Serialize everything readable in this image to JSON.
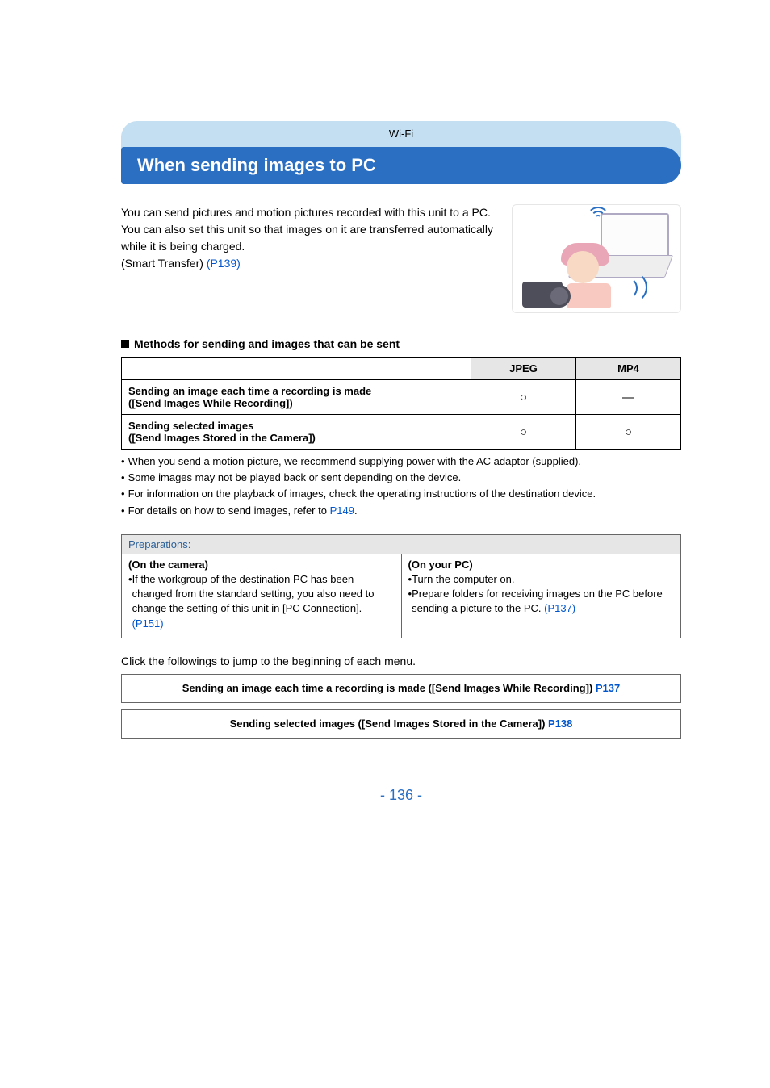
{
  "header": {
    "category": "Wi-Fi"
  },
  "title": "When sending images to PC",
  "intro": {
    "p1": "You can send pictures and motion pictures recorded with this unit to a PC.",
    "p2": "You can also set this unit so that images on it are transferred automatically while it is being charged.",
    "p3_prefix": "(Smart Transfer) ",
    "p3_link": "(P139)"
  },
  "methods_heading": "Methods for sending and images that can be sent",
  "table": {
    "jpeg": "JPEG",
    "mp4": "MP4",
    "row1_title_a": "Sending an image each time a recording is made",
    "row1_title_b": "([Send Images While Recording])",
    "row1_jpeg": "○",
    "row1_mp4": "—",
    "row2_title_a": "Sending selected images",
    "row2_title_b": "([Send Images Stored in the Camera])",
    "row2_jpeg": "○",
    "row2_mp4": "○"
  },
  "notes": {
    "n1": "When you send a motion picture, we recommend supplying power with the AC adaptor (supplied).",
    "n2": "Some images may not be played back or sent depending on the device.",
    "n3": "For information on the playback of images, check the operating instructions of the destination device.",
    "n4_prefix": "For details on how to send images, refer to ",
    "n4_link": "P149",
    "n4_suffix": "."
  },
  "prep": {
    "title": "Preparations:",
    "left_heading": "(On the camera)",
    "left_b1_prefix": "If the workgroup of the destination PC has been changed from the standard setting, you also need to change the setting of this unit in [PC Connection]. ",
    "left_b1_link": "(P151)",
    "right_heading": "(On your PC)",
    "right_b1": "Turn the computer on.",
    "right_b2_prefix": "Prepare folders for receiving images on the PC before sending a picture to the PC. ",
    "right_b2_link": "(P137)"
  },
  "jump": {
    "intro": "Click the followings to jump to the beginning of each menu.",
    "box1_text": "Sending an image each time a recording is made ([Send Images While Recording]) ",
    "box1_link": "P137",
    "box2_text": "Sending selected images ([Send Images Stored in the Camera]) ",
    "box2_link": "P138"
  },
  "page_number": "- 136 -"
}
